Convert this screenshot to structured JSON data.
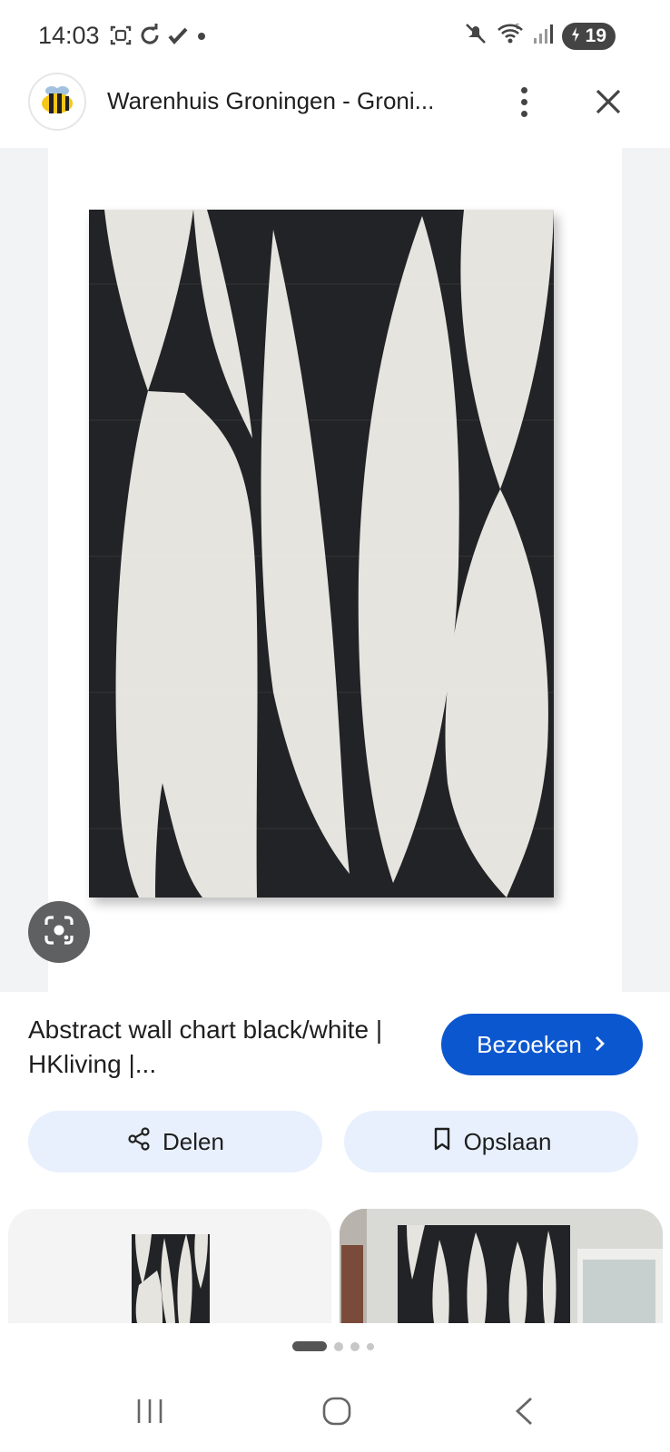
{
  "status_bar": {
    "time": "14:03",
    "battery": "19",
    "icons": [
      "screenshot-icon",
      "sync-icon",
      "check-icon",
      "dot-icon",
      "mute-icon",
      "wifi-icon",
      "signal-icon",
      "battery-icon"
    ]
  },
  "header": {
    "title": "Warenhuis Groningen - Groni...",
    "site_icon": "bee-logo-icon",
    "menu_icon": "more-vert-icon",
    "close_icon": "close-icon"
  },
  "result": {
    "title": "Abstract wall chart black/white | HKliving |...",
    "visit_label": "Bezoeken"
  },
  "actions": {
    "share_label": "Delen",
    "save_label": "Opslaan"
  },
  "colors": {
    "accent": "#0b57d0",
    "tonal_button": "#e8f0fe",
    "artwork_dark": "#222326",
    "artwork_light": "#e6e4df"
  },
  "carousel": {
    "active_page": 1,
    "pages": 4
  }
}
